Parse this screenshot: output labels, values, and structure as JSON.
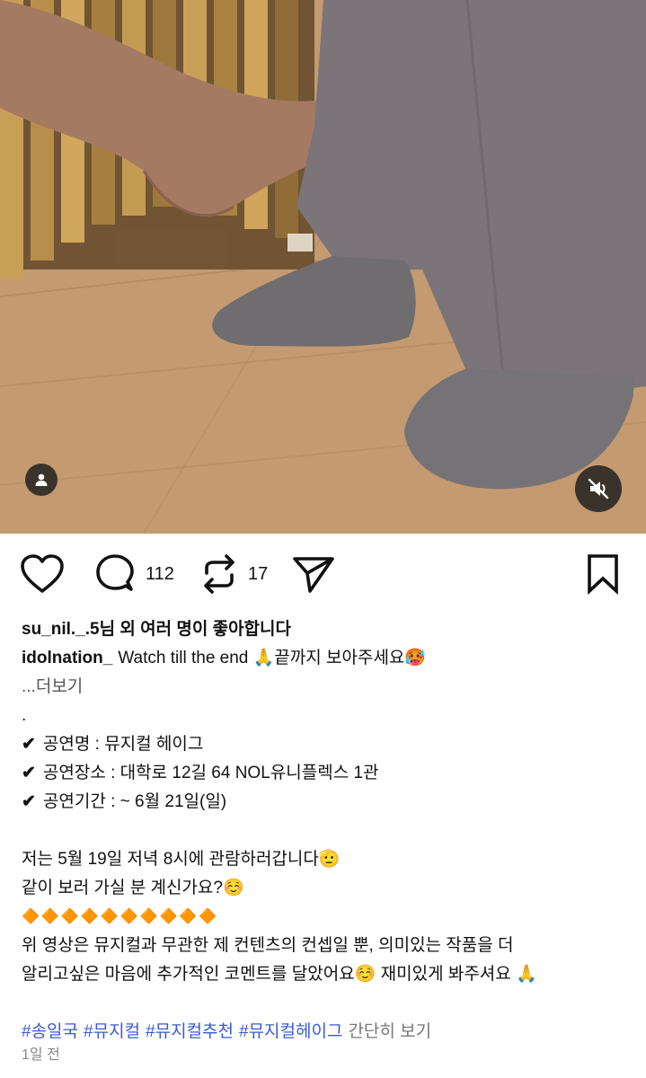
{
  "media": {
    "user_icon": "person-icon",
    "mute_icon": "speaker-muted-icon"
  },
  "actions": {
    "like_icon": "heart-icon",
    "comment_icon": "comment-bubble-icon",
    "comment_count": "112",
    "repost_icon": "repost-icon",
    "repost_count": "17",
    "share_icon": "send-icon",
    "save_icon": "bookmark-icon"
  },
  "likes": {
    "text": "su_nil._.5님 외 여러 명이 좋아합니다"
  },
  "caption": {
    "username": "idolnation_",
    "text": "Watch till the end 🙏끝까지 보아주세요🥵",
    "more": "...더보기"
  },
  "details": {
    "dot": ".",
    "lines": [
      "공연명 : 뮤지컬 헤이그",
      "공연장소 : 대학로 12길 64 NOL유니플렉스 1관",
      "공연기간 : ~ 6월 21일(일)"
    ],
    "check": "✔"
  },
  "body": {
    "line1": "저는 5월 19일 저녁 8시에 관람하러갑니다🫡",
    "line2": "같이 보러 가실 분 계신가요?☺️",
    "diamonds": "🔶🔶🔶🔶🔶🔶🔶🔶🔶🔶",
    "line3": "위 영상은 뮤지컬과 무관한 제 컨텐츠의 컨셉일 뿐, 의미있는 작품을 더",
    "line4": "알리고싶은 마음에 추가적인 코멘트를 달았어요☺️ 재미있게 봐주셔요 🙏"
  },
  "hashtags": [
    "#송일국",
    "#뮤지컬",
    "#뮤지컬추천",
    "#뮤지컬헤이그"
  ],
  "collapse_label": "간단히 보기",
  "timestamp": "1일 전",
  "colors": {
    "hashtag": "#3a5ad4",
    "diamond": "#f07a1a"
  }
}
